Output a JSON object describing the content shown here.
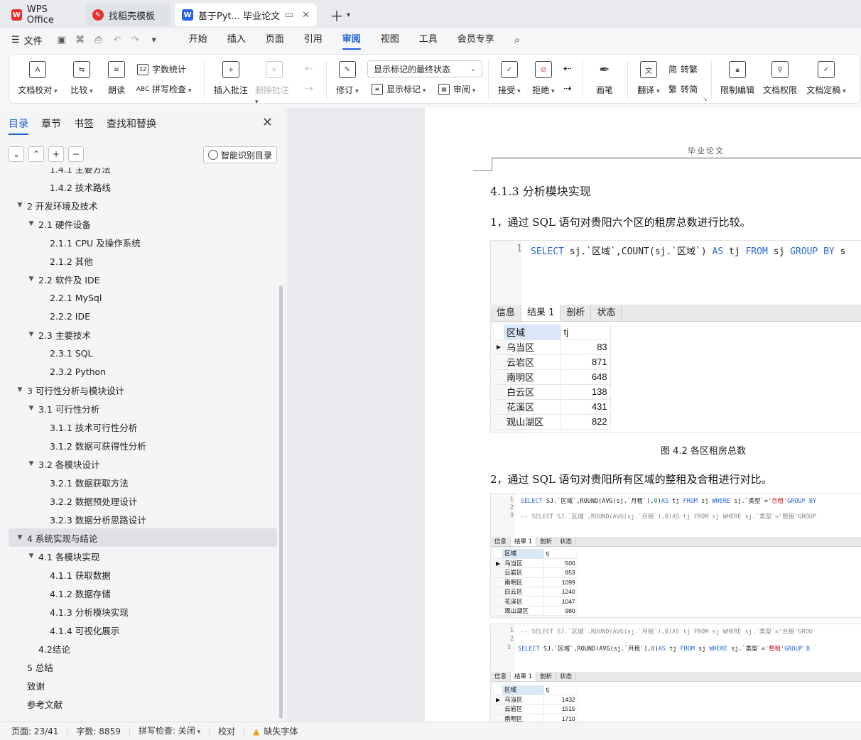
{
  "tabs": {
    "wps": "WPS Office",
    "template": "找稻壳模板",
    "doc": "基于Pyt... 毕业论文"
  },
  "menu": {
    "file": "文件",
    "tabs": [
      "开始",
      "插入",
      "页面",
      "引用",
      "审阅",
      "视图",
      "工具",
      "会员专享"
    ],
    "active": "审阅"
  },
  "ribbon": {
    "doc_proof": "文档校对",
    "compare": "比较",
    "read_aloud": "朗读",
    "word_count": "字数统计",
    "spell_check": "拼写检查",
    "insert_comment": "插入批注",
    "delete_comment": "删除批注",
    "track_changes": "修订",
    "markup_state": "显示标记的最终状态",
    "show_markup": "显示标记",
    "review": "审阅",
    "accept": "接受",
    "reject": "拒绝",
    "pen": "画笔",
    "translate": "翻译",
    "to_traditional": "转繁",
    "to_simplified": "转简",
    "restrict_edit": "限制编辑",
    "doc_permission": "文档权限",
    "doc_finalize": "文档定稿",
    "trad_glyph": "简",
    "simp_glyph": "繁"
  },
  "nav": {
    "tabs": [
      "目录",
      "章节",
      "书签",
      "查找和替换"
    ],
    "smart_toc": "智能识别目录",
    "toc": [
      {
        "label": "1.4.1  主要方法",
        "level": 3,
        "caret": false
      },
      {
        "label": "1.4.2  技术路线",
        "level": 3,
        "caret": false
      },
      {
        "label": "2 开发环境及技术",
        "level": 1,
        "caret": true
      },
      {
        "label": "2.1 硬件设备",
        "level": 2,
        "caret": true
      },
      {
        "label": "2.1.1 CPU 及操作系统",
        "level": 3,
        "caret": false
      },
      {
        "label": "2.1.2  其他",
        "level": 3,
        "caret": false
      },
      {
        "label": "2.2 软件及 IDE",
        "level": 2,
        "caret": true
      },
      {
        "label": "2.2.1 MySql",
        "level": 3,
        "caret": false
      },
      {
        "label": "2.2.2 IDE",
        "level": 3,
        "caret": false
      },
      {
        "label": "2.3 主要技术",
        "level": 2,
        "caret": true
      },
      {
        "label": "2.3.1 SQL",
        "level": 3,
        "caret": false
      },
      {
        "label": "2.3.2 Python",
        "level": 3,
        "caret": false
      },
      {
        "label": "3  可行性分析与模块设计",
        "level": 1,
        "caret": true
      },
      {
        "label": "3.1  可行性分析",
        "level": 2,
        "caret": true
      },
      {
        "label": "3.1.1  技术可行性分析",
        "level": 3,
        "caret": false
      },
      {
        "label": "3.1.2  数据可获得性分析",
        "level": 3,
        "caret": false
      },
      {
        "label": "3.2  各模块设计",
        "level": 2,
        "caret": true
      },
      {
        "label": "3.2.1  数据获取方法",
        "level": 3,
        "caret": false
      },
      {
        "label": "3.2.2  数据预处理设计",
        "level": 3,
        "caret": false
      },
      {
        "label": "3.2.3  数据分析思路设计",
        "level": 3,
        "caret": false
      },
      {
        "label": "4  系统实现与结论",
        "level": 1,
        "caret": true,
        "selected": true
      },
      {
        "label": "4.1  各模块实现",
        "level": 2,
        "caret": true
      },
      {
        "label": "4.1.1  获取数据",
        "level": 3,
        "caret": false
      },
      {
        "label": "4.1.2  数据存储",
        "level": 3,
        "caret": false
      },
      {
        "label": "4.1.3  分析模块实现",
        "level": 3,
        "caret": false
      },
      {
        "label": "4.1.4  可视化展示",
        "level": 3,
        "caret": false
      },
      {
        "label": "4.2结论",
        "level": 2,
        "caret": false
      },
      {
        "label": "5 总结",
        "level": 1,
        "caret": false
      },
      {
        "label": "致谢",
        "level": 1,
        "caret": false
      },
      {
        "label": "参考文献",
        "level": 1,
        "caret": false
      }
    ]
  },
  "document": {
    "running_header": "毕业论文",
    "section_title": "4.1.3  分析模块实现",
    "para1": "1，通过 SQL 语句对贵阳六个区的租房总数进行比较。",
    "para2": "2，通过 SQL 语句对贵阳所有区域的整租及合租进行对比。",
    "caption1": "图 4.2 各区租房总数",
    "result_tabs": [
      "信息",
      "结果 1",
      "剖析",
      "状态"
    ],
    "shot1": {
      "line_no": "1",
      "sql": {
        "kw1": "SELECT",
        "t1": " sj.`区域`,COUNT(sj.`区域`) ",
        "kw2": "AS",
        "t2": " tj ",
        "kw3": "FROM",
        "t3": " sj ",
        "kw4": "GROUP BY",
        "t4": " s"
      },
      "columns": [
        "区域",
        "tj"
      ],
      "rows": [
        [
          "乌当区",
          "83"
        ],
        [
          "云岩区",
          "871"
        ],
        [
          "南明区",
          "648"
        ],
        [
          "白云区",
          "138"
        ],
        [
          "花溪区",
          "431"
        ],
        [
          "观山湖区",
          "822"
        ]
      ]
    },
    "shot2": {
      "line1": {
        "no": "1",
        "kw1": "SELECT",
        "t1": " SJ.`区域`,ROUND(AVG(sj.`月租`),",
        "n1": "0",
        "t2": ")",
        "kw2": "AS",
        "t3": " tj ",
        "kw3": "FROM",
        "t4": " sj ",
        "kw4": "WHERE",
        "t5": " sj.`类型`=",
        "s1": "'合租'",
        "kw5": "GROUP BY"
      },
      "line2": {
        "no": "2",
        "text": ""
      },
      "line3": {
        "no": "3",
        "text": "-- SELECT SJ.`区域`,ROUND(AVG(sj.`月租`),0)AS tj FROM sj WHERE sj.`类型`='整租'GROUP"
      },
      "columns": [
        "区域",
        "tj"
      ],
      "rows": [
        [
          "乌当区",
          "500"
        ],
        [
          "云岩区",
          "853"
        ],
        [
          "南明区",
          "1099"
        ],
        [
          "白云区",
          "1240"
        ],
        [
          "花溪区",
          "1047"
        ],
        [
          "观山湖区",
          "980"
        ]
      ]
    },
    "shot3": {
      "line1": {
        "no": "1",
        "text": "-- SELECT SJ.`区域`,ROUND(AVG(sj.`月租`),0)AS tj FROM sj WHERE sj.`类型`='合租'GROU"
      },
      "line2": {
        "no": "2",
        "text": ""
      },
      "line3": {
        "no": "3",
        "kw1": "SELECT",
        "t1": " SJ.`区域`,ROUND(AVG(sj.`月租`),",
        "n1": "0",
        "t2": ")",
        "kw2": "AS",
        "t3": " tj ",
        "kw3": "FROM",
        "t4": " sj ",
        "kw4": "WHERE",
        "t5": " sj.`类型`=",
        "s1": "'整租'",
        "kw5": "GROUP B"
      },
      "columns": [
        "区域",
        "tj"
      ],
      "rows": [
        [
          "乌当区",
          "1432"
        ],
        [
          "云岩区",
          "1515"
        ],
        [
          "南明区",
          "1710"
        ]
      ]
    }
  },
  "status": {
    "page": "页面: 23/41",
    "words": "字数: 8859",
    "spell": "拼写检查: 关闭",
    "proof": "校对",
    "missing_font": "缺失字体"
  }
}
